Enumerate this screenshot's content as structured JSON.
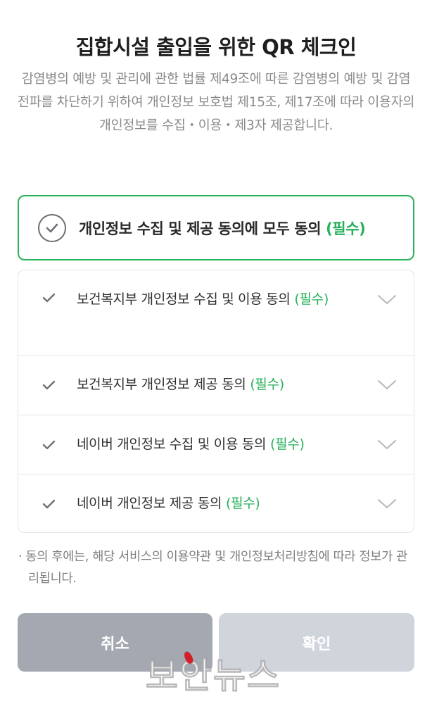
{
  "header": {
    "title": "집합시설 출입을 위한 QR 체크인",
    "description": "감염병의 예방 및 관리에 관한 법률 제49조에 따른 감염병의 예방 및 감염 전파를 차단하기 위하여 개인정보 보호법 제15조, 제17조에 따라 이용자의 개인정보를 수집・이용・제3자 제공합니다."
  },
  "agree_all": {
    "label": "개인정보 수집 및 제공 동의에 모두 동의",
    "required": "(필수)",
    "checked": false
  },
  "consents": [
    {
      "label": "보건복지부 개인정보 수집 및 이용 동의",
      "required": "(필수)"
    },
    {
      "label": "보건복지부 개인정보 제공 동의",
      "required": "(필수)"
    },
    {
      "label": "네이버 개인정보 수집 및 이용 동의",
      "required": "(필수)"
    },
    {
      "label": "네이버 개인정보 제공 동의",
      "required": "(필수)"
    }
  ],
  "note": "· 동의 후에는, 해당 서비스의 이용약관 및 개인정보처리방침에 따라 정보가 관리됩니다.",
  "buttons": {
    "cancel": "취소",
    "confirm": "확인"
  },
  "watermark": "보안뉴스",
  "colors": {
    "accent": "#28b25c",
    "cancel_bg": "#a3a8b1",
    "confirm_disabled_bg": "#d0d5dc"
  },
  "icons": {
    "agree_all": "circle-check-icon",
    "item_check": "checkmark-icon",
    "expand": "chevron-down-icon"
  }
}
